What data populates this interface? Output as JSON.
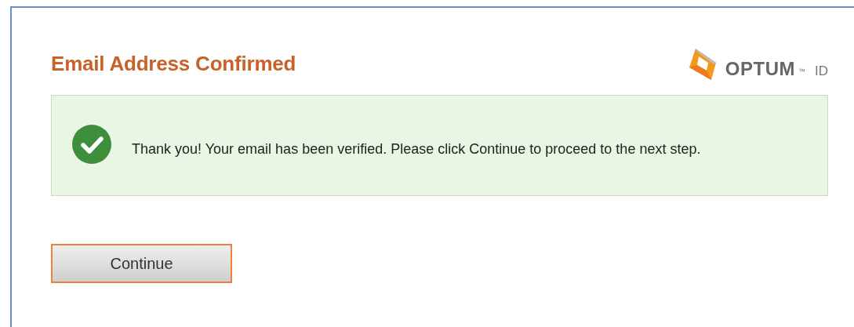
{
  "title": "Email Address Confirmed",
  "logo": {
    "name": "OPTUM",
    "trademark": "™",
    "suffix": "ID"
  },
  "message": {
    "kind": "success",
    "text": "Thank you! Your email has been verified.  Please click Continue to proceed to the next step."
  },
  "buttons": [
    {
      "label": "Continue",
      "focused": true
    }
  ]
}
